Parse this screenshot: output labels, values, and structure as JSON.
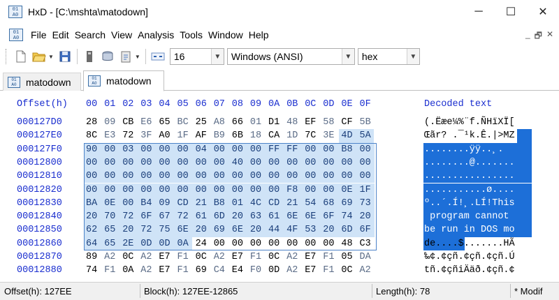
{
  "window": {
    "title": "HxD - [C:\\mshta\\matodown]",
    "minimize": "─",
    "maximize": "☐",
    "close": "✕"
  },
  "menu": {
    "items": [
      "File",
      "Edit",
      "Search",
      "View",
      "Analysis",
      "Tools",
      "Window",
      "Help"
    ],
    "mdi_minimize": "_",
    "mdi_restore": "🗗",
    "mdi_close": "✕"
  },
  "toolbar": {
    "bytes_per_row": "16",
    "charset": "Windows (ANSI)",
    "offset_base": "hex"
  },
  "tabs": [
    {
      "label": "matodown",
      "active": false
    },
    {
      "label": "matodown",
      "active": true
    }
  ],
  "hex": {
    "offset_header": "Offset(h)",
    "column_headers": [
      "00",
      "01",
      "02",
      "03",
      "04",
      "05",
      "06",
      "07",
      "08",
      "09",
      "0A",
      "0B",
      "0C",
      "0D",
      "0E",
      "0F"
    ],
    "decoded_header": "Decoded text",
    "rows": [
      {
        "offset": "000127D0",
        "bytes": [
          "28",
          "09",
          "CB",
          "E6",
          "65",
          "BC",
          "25",
          "A8",
          "66",
          "01",
          "D1",
          "48",
          "EF",
          "58",
          "CF",
          "5B"
        ],
        "decoded": "(.Ëæe¼%¨f.ÑHïXÏ["
      },
      {
        "offset": "000127E0",
        "bytes": [
          "8C",
          "E3",
          "72",
          "3F",
          "A0",
          "1F",
          "AF",
          "B9",
          "6B",
          "18",
          "CA",
          "1D",
          "7C",
          "3E",
          "4D",
          "5A"
        ],
        "decoded": "Œãr? .¯¹k.Ê.|>MZ"
      },
      {
        "offset": "000127F0",
        "bytes": [
          "90",
          "00",
          "03",
          "00",
          "00",
          "00",
          "04",
          "00",
          "00",
          "00",
          "FF",
          "FF",
          "00",
          "00",
          "B8",
          "00"
        ],
        "decoded": "........ÿÿ..¸."
      },
      {
        "offset": "00012800",
        "bytes": [
          "00",
          "00",
          "00",
          "00",
          "00",
          "00",
          "00",
          "00",
          "40",
          "00",
          "00",
          "00",
          "00",
          "00",
          "00",
          "00"
        ],
        "decoded": "........@......."
      },
      {
        "offset": "00012810",
        "bytes": [
          "00",
          "00",
          "00",
          "00",
          "00",
          "00",
          "00",
          "00",
          "00",
          "00",
          "00",
          "00",
          "00",
          "00",
          "00",
          "00"
        ],
        "decoded": "................"
      },
      {
        "offset": "00012820",
        "bytes": [
          "00",
          "00",
          "00",
          "00",
          "00",
          "00",
          "00",
          "00",
          "00",
          "00",
          "00",
          "F8",
          "00",
          "00",
          "0E",
          "1F"
        ],
        "decoded": "...........ø...."
      },
      {
        "offset": "00012830",
        "bytes": [
          "BA",
          "0E",
          "00",
          "B4",
          "09",
          "CD",
          "21",
          "B8",
          "01",
          "4C",
          "CD",
          "21",
          "54",
          "68",
          "69",
          "73"
        ],
        "decoded": "º..´.Í!¸.LÍ!This"
      },
      {
        "offset": "00012840",
        "bytes": [
          "20",
          "70",
          "72",
          "6F",
          "67",
          "72",
          "61",
          "6D",
          "20",
          "63",
          "61",
          "6E",
          "6E",
          "6F",
          "74",
          "20"
        ],
        "decoded": " program cannot "
      },
      {
        "offset": "00012850",
        "bytes": [
          "62",
          "65",
          "20",
          "72",
          "75",
          "6E",
          "20",
          "69",
          "6E",
          "20",
          "44",
          "4F",
          "53",
          "20",
          "6D",
          "6F"
        ],
        "decoded": "be run in DOS mo"
      },
      {
        "offset": "00012860",
        "bytes": [
          "64",
          "65",
          "2E",
          "0D",
          "0D",
          "0A",
          "24",
          "00",
          "00",
          "00",
          "00",
          "00",
          "00",
          "00",
          "48",
          "C3"
        ],
        "decoded": "de....$.......HÃ"
      },
      {
        "offset": "00012870",
        "bytes": [
          "89",
          "A2",
          "0C",
          "A2",
          "E7",
          "F1",
          "0C",
          "A2",
          "E7",
          "F1",
          "0C",
          "A2",
          "E7",
          "F1",
          "05",
          "DA"
        ],
        "decoded": "‰¢.¢çñ.¢çñ.¢çñ.Ú"
      },
      {
        "offset": "00012880",
        "bytes": [
          "74",
          "F1",
          "0A",
          "A2",
          "E7",
          "F1",
          "69",
          "C4",
          "E4",
          "F0",
          "0D",
          "A2",
          "E7",
          "F1",
          "0C",
          "A2"
        ],
        "decoded": "tñ.¢çñiÄäð.¢çñ.¢"
      }
    ]
  },
  "status": {
    "offset": "Offset(h): 127EE",
    "block": "Block(h): 127EE-12865",
    "length": "Length(h): 78",
    "mode": "* Modif"
  }
}
